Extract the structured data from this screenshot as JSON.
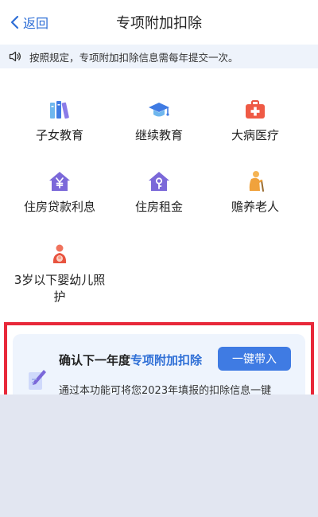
{
  "header": {
    "back_label": "返回",
    "title": "专项附加扣除"
  },
  "notice": {
    "text": "按照规定，专项附加扣除信息需每年提交一次。"
  },
  "items": [
    {
      "label": "子女教育",
      "icon": "books-icon"
    },
    {
      "label": "继续教育",
      "icon": "graduation-cap-icon"
    },
    {
      "label": "大病医疗",
      "icon": "medical-kit-icon"
    },
    {
      "label": "住房贷款利息",
      "icon": "house-yuan-icon"
    },
    {
      "label": "住房租金",
      "icon": "house-key-icon"
    },
    {
      "label": "赡养老人",
      "icon": "elderly-person-icon"
    },
    {
      "label": "3岁以下婴幼儿照",
      "label2": "护",
      "icon": "mother-baby-icon"
    }
  ],
  "card": {
    "heading_prefix": "确认下一年度",
    "heading_highlight": "专项附加扣除",
    "button_label": "一键带入",
    "description": "通过本功能可将您2023年填报的扣除信息一键"
  },
  "colors": {
    "accent": "#2f6fd6",
    "purple": "#7b68d9",
    "orange": "#f0a23c",
    "red": "#e8283a"
  }
}
